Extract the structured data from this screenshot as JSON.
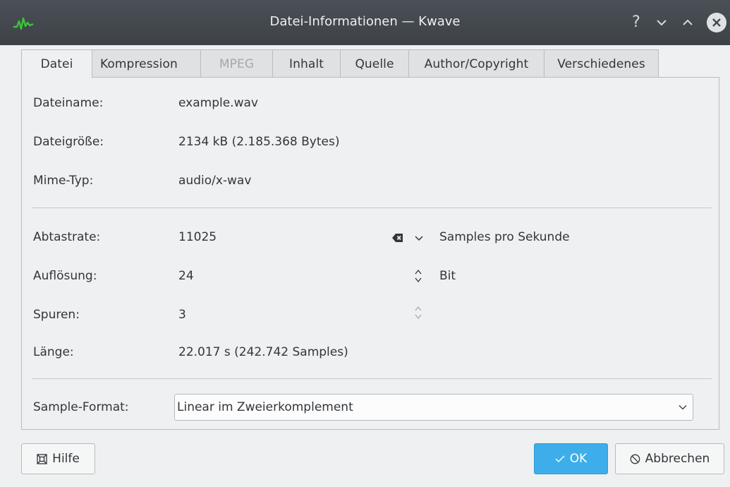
{
  "window": {
    "title": "Datei-Informationen — Kwave",
    "help_glyph": "?",
    "min_glyph": "⌄",
    "max_glyph": "⌃"
  },
  "tabs": [
    {
      "label": "Datei",
      "active": true,
      "enabled": true
    },
    {
      "label": "Kompression",
      "active": false,
      "enabled": true
    },
    {
      "label": "MPEG",
      "active": false,
      "enabled": false
    },
    {
      "label": "Inhalt",
      "active": false,
      "enabled": true
    },
    {
      "label": "Quelle",
      "active": false,
      "enabled": true
    },
    {
      "label": "Author/Copyright",
      "active": false,
      "enabled": true
    },
    {
      "label": "Verschiedenes",
      "active": false,
      "enabled": true
    }
  ],
  "file": {
    "name_label": "Dateiname:",
    "name_value": "example.wav",
    "size_label": "Dateigröße:",
    "size_value": "2134 kB (2.185.368 Bytes)",
    "mime_label": "Mime-Typ:",
    "mime_value": "audio/x-wav"
  },
  "format": {
    "rate_label": "Abtastrate:",
    "rate_value": "11025",
    "rate_unit": "Samples pro Sekunde",
    "resolution_label": "Auflösung:",
    "resolution_value": "24",
    "resolution_unit": "Bit",
    "tracks_label": "Spuren:",
    "tracks_value": "3",
    "length_label": "Länge:",
    "length_value": "22.017 s (242.742 Samples)",
    "sample_format_label": "Sample-Format:",
    "sample_format_value": "Linear im Zweierkomplement"
  },
  "buttons": {
    "help_label": "Hilfe",
    "ok_label": "OK",
    "cancel_label": "Abbrechen"
  },
  "colors": {
    "accent": "#3daee9",
    "titlebar": "#43494e",
    "background": "#eff0f1"
  }
}
